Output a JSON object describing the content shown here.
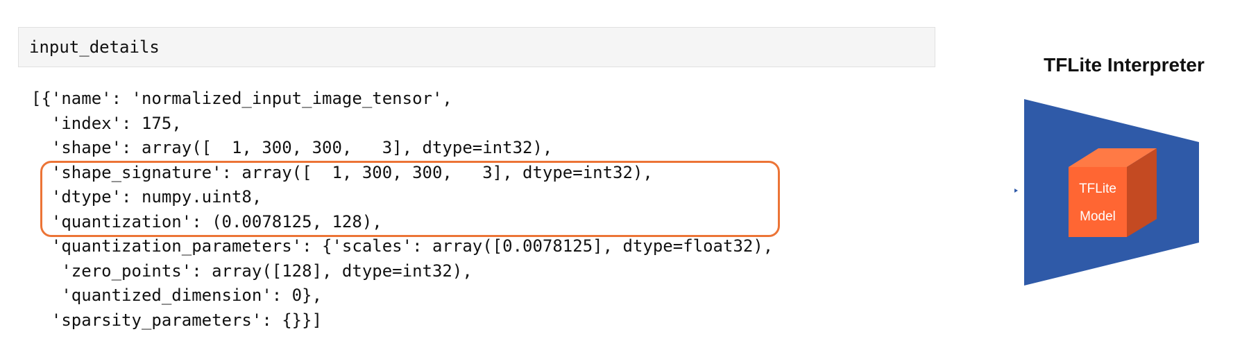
{
  "notebook": {
    "input_code": "input_details",
    "output_lines": [
      "[{'name': 'normalized_input_image_tensor',",
      "  'index': 175,",
      "  'shape': array([  1, 300, 300,   3], dtype=int32),",
      "  'shape_signature': array([  1, 300, 300,   3], dtype=int32),",
      "  'dtype': numpy.uint8,",
      "  'quantization': (0.0078125, 128),",
      "  'quantization_parameters': {'scales': array([0.0078125], dtype=float32),",
      "   'zero_points': array([128], dtype=int32),",
      "   'quantized_dimension': 0},",
      "  'sparsity_parameters': {}}]"
    ]
  },
  "diagram": {
    "title": "TFLite Interpreter",
    "model_label_line1": "TFLite",
    "model_label_line2": "Model",
    "colors": {
      "interpreter": "#2f5aa8",
      "cube_front": "#ff6633",
      "cube_top": "#ff7a45",
      "cube_side": "#c44a22",
      "highlight_border": "#ec7436"
    }
  }
}
